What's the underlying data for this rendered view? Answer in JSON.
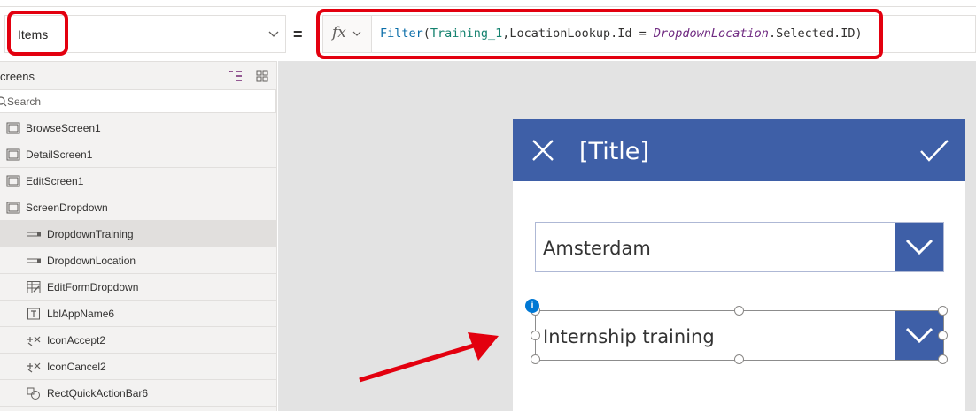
{
  "property_bar": {
    "selected_property": "Items",
    "equals": "="
  },
  "formula_bar": {
    "fx_label": "fx",
    "formula": {
      "fn": "Filter",
      "open": "(",
      "arg1": "Training_1",
      "part2": ",LocationLookup.Id = ",
      "arg2": "DropdownLocation",
      "part3": ".Selected.ID)"
    }
  },
  "tree_panel": {
    "title": "creens",
    "search_placeholder": "Search",
    "items": [
      {
        "label": "BrowseScreen1",
        "icon": "screen-icon"
      },
      {
        "label": "DetailScreen1",
        "icon": "screen-icon"
      },
      {
        "label": "EditScreen1",
        "icon": "screen-icon"
      },
      {
        "label": "ScreenDropdown",
        "icon": "screen-icon"
      },
      {
        "label": "DropdownTraining",
        "icon": "dropdown-control-icon"
      },
      {
        "label": "DropdownLocation",
        "icon": "dropdown-control-icon"
      },
      {
        "label": "EditFormDropdown",
        "icon": "form-icon"
      },
      {
        "label": "LblAppName6",
        "icon": "label-icon"
      },
      {
        "label": "IconAccept2",
        "icon": "icon-control-icon"
      },
      {
        "label": "IconCancel2",
        "icon": "icon-control-icon"
      },
      {
        "label": "RectQuickActionBar6",
        "icon": "shape-icon"
      }
    ]
  },
  "canvas": {
    "title": "[Title]",
    "dropdown_location_value": "Amsterdam",
    "dropdown_training_value": "Internship training",
    "info_badge": "i"
  },
  "colors": {
    "accent": "#3e5fa7",
    "annotation_red": "#e3000f",
    "selection_blue": "#0078d4"
  }
}
